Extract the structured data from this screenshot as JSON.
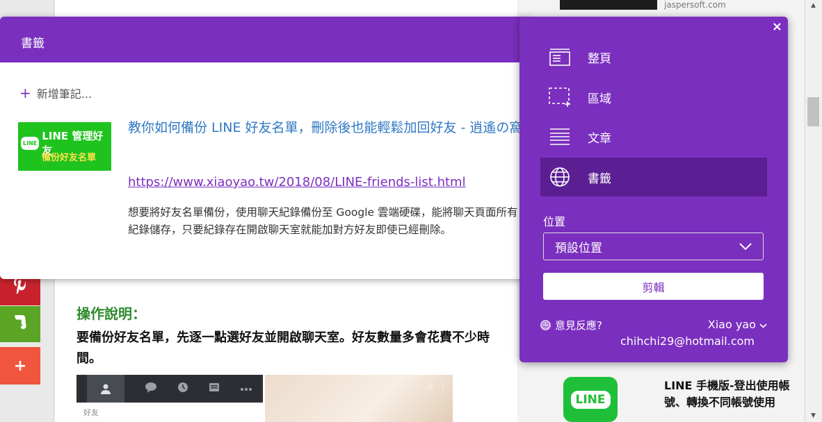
{
  "background_page": {
    "operation_title": "操作說明：",
    "operation_text": "要備份好友名單，先逐一點選好友並開啟聊天室。好友數量多會花費不少時間。",
    "friend_tab_label": "好友",
    "share_more_icon": "+",
    "ad_label": "jaspersoft.com",
    "right_logo_text": "LINE",
    "right_article_text": "LINE 手機版-登出使用帳號、轉換不同帳號使用"
  },
  "clipper": {
    "header_title": "書籤",
    "add_note_label": "新增筆記...",
    "thumbnail": {
      "line_badge": "LINE",
      "line1": "LINE 管理好友",
      "line2": "備份好友名單"
    },
    "bookmark_title": "教你如何備份 LINE 好友名單，刪除後也能輕鬆加回好友 - 逍遙の窩",
    "bookmark_url": "https://www.xiaoyao.tw/2018/08/LINE-friends-list.html",
    "bookmark_description": "想要將好友名單備份，使用聊天紀錄備份至 Google 雲端硬碟，能將聊天頁面所有紀錄儲存，只要紀錄存在開啟聊天室就能加對方好友即使已經刪除。"
  },
  "menu": {
    "close_icon": "×",
    "items": [
      {
        "label": "整頁",
        "icon": "full-page-icon"
      },
      {
        "label": "區域",
        "icon": "region-select-icon"
      },
      {
        "label": "文章",
        "icon": "article-icon"
      },
      {
        "label": "書籤",
        "icon": "globe-icon",
        "selected": true
      }
    ],
    "location_label": "位置",
    "location_value": "預設位置",
    "clip_button": "剪輯",
    "feedback_label": "意見反應?",
    "user_name": "Xiao yao",
    "user_email": "chihchi29@hotmail.com"
  },
  "colors": {
    "brand_purple": "#7b2fbf",
    "selected_purple": "#5c1f93",
    "link_blue": "#2f78c4",
    "line_green": "#1ec31e"
  }
}
